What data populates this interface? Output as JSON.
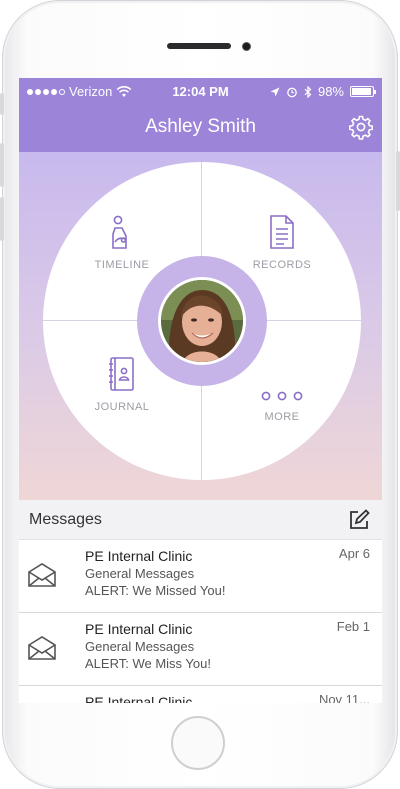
{
  "status_bar": {
    "carrier": "Verizon",
    "time": "12:04 PM",
    "battery": "98%"
  },
  "header": {
    "title": "Ashley Smith"
  },
  "menu": {
    "timeline": "TIMELINE",
    "records": "RECORDS",
    "journal": "JOURNAL",
    "more": "MORE"
  },
  "messages": {
    "label": "Messages",
    "items": [
      {
        "from": "PE Internal Clinic",
        "category": "General Messages",
        "preview": "ALERT: We Missed You!",
        "date": "Apr 6"
      },
      {
        "from": "PE Internal Clinic",
        "category": "General Messages",
        "preview": "ALERT: We Miss You!",
        "date": "Feb 1"
      },
      {
        "from": "PE Internal Clinic",
        "category": "",
        "preview": "",
        "date": "Nov 11..."
      }
    ]
  },
  "colors": {
    "header": "#9c84d8",
    "accent": "#8a6fc7",
    "ring": "#c6b4e8"
  },
  "icons": [
    "wifi-icon",
    "location-icon",
    "alarm-icon",
    "bluetooth-icon",
    "battery-icon",
    "gear-icon",
    "timeline-icon",
    "records-icon",
    "journal-icon",
    "more-icon",
    "compose-icon",
    "envelope-icon"
  ]
}
